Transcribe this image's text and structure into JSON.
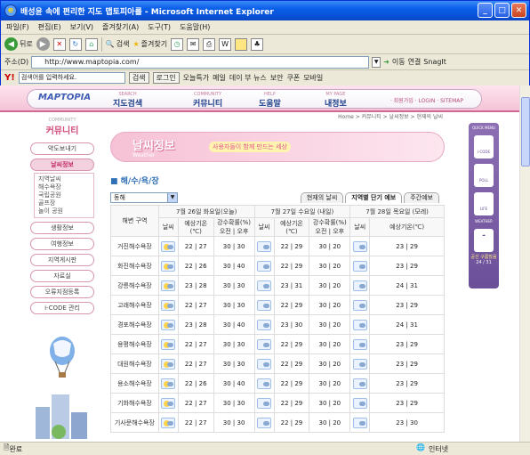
{
  "window": {
    "title": "배성윤 속에 편리한 지도 맵토피아를 - Microsoft Internet Explorer"
  },
  "menu": [
    "파일(F)",
    "편집(E)",
    "보기(V)",
    "즐겨찾기(A)",
    "도구(T)",
    "도움말(H)"
  ],
  "toolbar": {
    "back": "뒤로",
    "search": "검색",
    "favorites": "즐겨찾기"
  },
  "address": {
    "label": "주소(D)",
    "url": "http://www.maptopia.com/",
    "go": "이동",
    "links": "연결",
    "snagit": "SnagIt"
  },
  "yahoo": {
    "search_placeholder": "검색어를 입력하세요.",
    "search_btn": "검색",
    "login": "로그인",
    "items": [
      "오늘특가",
      "메일",
      "데이 부 뉴스",
      "보안",
      "쿠폰",
      "모바일"
    ]
  },
  "site": {
    "logo": "MAPTOPIA",
    "nav": [
      {
        "en": "SEARCH",
        "ko": "지도검색"
      },
      {
        "en": "COMMUNITY",
        "ko": "커뮤니티"
      },
      {
        "en": "HELP",
        "ko": "도움말"
      },
      {
        "en": "MY PAGE",
        "ko": "내정보"
      }
    ],
    "toplinks": "· 회원가입 · LOGIN · SITEMAP",
    "breadcrumb": "Home > 커뮤니티 > 날씨정보 > 현재의 날씨",
    "side_en": "COMMUNITY",
    "side_title": "커뮤니티",
    "side_items": [
      "약도보내기",
      "날씨정보",
      "생활정보",
      "여행정보",
      "지역게시판",
      "자료실",
      "오류지점등록",
      "i-CODE 관리"
    ],
    "side_sub": [
      "지역날씨",
      "해수욕장",
      "국립공원",
      "골프장",
      "놀이 공원"
    ],
    "banner_title": "날씨정보",
    "banner_en": "Weather",
    "banner_slogan": "사용자들이 함께 만드는 세상",
    "section": "해/수/욕/장",
    "select": "동해",
    "tabs": [
      "현재의 날씨",
      "지역별 단기 예보",
      "주간예보"
    ],
    "col_area": "해변 구역",
    "days": [
      "7월 26일 화요일(오늘)",
      "7월 27일 수요일 (내일)",
      "7월 28일 목요일 (모레)"
    ],
    "sub_weather": "날씨",
    "sub_temp": "예상기온(℃)",
    "sub_rain": "강수확률(%) 오전 | 오후",
    "rows": [
      {
        "name": "거진해수욕장",
        "t1": "22 | 27",
        "r1": "30 | 30",
        "t2": "22 | 29",
        "r2": "30 | 20",
        "t3": "23 | 29"
      },
      {
        "name": "화진해수욕장",
        "t1": "22 | 26",
        "r1": "30 | 40",
        "t2": "22 | 29",
        "r2": "30 | 20",
        "t3": "23 | 29"
      },
      {
        "name": "강릉해수욕장",
        "t1": "23 | 28",
        "r1": "30 | 30",
        "t2": "23 | 31",
        "r2": "30 | 20",
        "t3": "24 | 31"
      },
      {
        "name": "고래해수욕장",
        "t1": "22 | 27",
        "r1": "30 | 30",
        "t2": "22 | 29",
        "r2": "30 | 20",
        "t3": "23 | 29"
      },
      {
        "name": "경포해수욕장",
        "t1": "23 | 28",
        "r1": "30 | 40",
        "t2": "23 | 30",
        "r2": "30 | 20",
        "t3": "24 | 31"
      },
      {
        "name": "용평해수욕장",
        "t1": "22 | 27",
        "r1": "30 | 30",
        "t2": "22 | 29",
        "r2": "30 | 20",
        "t3": "23 | 29"
      },
      {
        "name": "대원해수욕장",
        "t1": "22 | 27",
        "r1": "30 | 30",
        "t2": "22 | 29",
        "r2": "30 | 20",
        "t3": "23 | 29"
      },
      {
        "name": "용소해수욕장",
        "t1": "22 | 26",
        "r1": "30 | 40",
        "t2": "22 | 29",
        "r2": "30 | 20",
        "t3": "23 | 29"
      },
      {
        "name": "기화해수욕장",
        "t1": "22 | 27",
        "r1": "30 | 30",
        "t2": "22 | 29",
        "r2": "30 | 20",
        "t3": "23 | 29"
      },
      {
        "name": "기사문해수욕장",
        "t1": "22 | 27",
        "r1": "30 | 30",
        "t2": "22 | 29",
        "r2": "30 | 20",
        "t3": "23 | 30"
      }
    ],
    "right_bar": {
      "title": "QUICK MENU",
      "items": [
        "i-CODE",
        "POLL",
        "LIFE"
      ],
      "weather_label": "WEATHER",
      "weather_text": "공선 구름많음",
      "weather_temp": "24 / 31"
    }
  },
  "status": {
    "left": "완료",
    "right": "인터넷"
  }
}
